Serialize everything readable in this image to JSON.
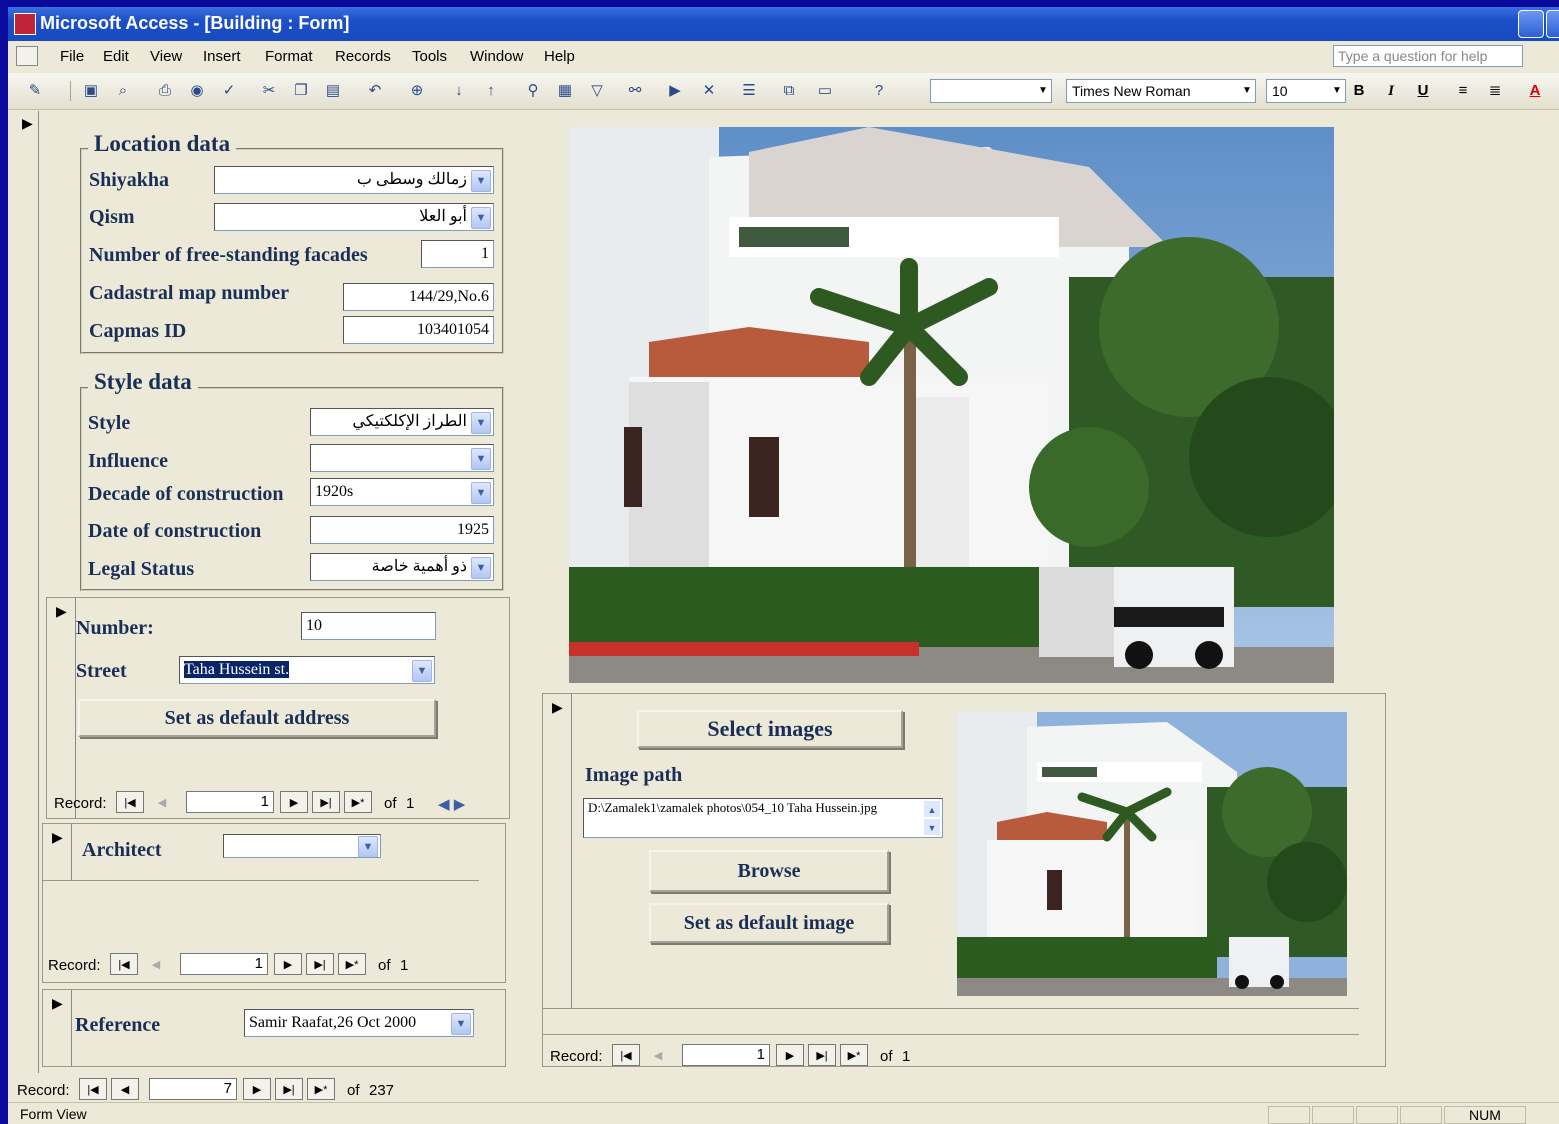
{
  "window": {
    "title": "Microsoft Access - [Building : Form]"
  },
  "menu": [
    "File",
    "Edit",
    "View",
    "Insert",
    "Format",
    "Records",
    "Tools",
    "Window",
    "Help"
  ],
  "help_placeholder": "Type a question for help",
  "toolbar": {
    "font": "Times New Roman",
    "size": "10",
    "bold": "B",
    "italic": "I",
    "underline": "U",
    "font_color": "A"
  },
  "location": {
    "title": "Location data",
    "shiyakha_label": "Shiyakha",
    "shiyakha_value": "زمالك وسطى ب",
    "qism_label": "Qism",
    "qism_value": "أبو العلا",
    "facades_label": "Number of free-standing facades",
    "facades_value": "1",
    "cadastral_label": "Cadastral map number",
    "cadastral_value": "144/29,No.6",
    "capmas_label": "Capmas ID",
    "capmas_value": "103401054"
  },
  "style": {
    "title": "Style data",
    "style_label": "Style",
    "style_value": "الطراز الإكلكتيكي",
    "influence_label": "Influence",
    "influence_value": "",
    "decade_label": "Decade of construction",
    "decade_value": "1920s",
    "date_label": "Date of construction",
    "date_value": "1925",
    "legal_label": "Legal Status",
    "legal_value": "ذو أهمية خاصة"
  },
  "address": {
    "number_label": "Number:",
    "number_value": "10",
    "street_label": "Street",
    "street_value": "Taha Hussein st.",
    "default_button": "Set as default address",
    "nav": {
      "label": "Record:",
      "current": "1",
      "of": "of",
      "total": "1"
    }
  },
  "architect": {
    "label": "Architect",
    "value": "",
    "nav": {
      "label": "Record:",
      "current": "1",
      "of": "of",
      "total": "1"
    }
  },
  "reference": {
    "label": "Reference",
    "value": "Samir Raafat,26 Oct 2000"
  },
  "main_nav": {
    "label": "Record:",
    "current": "7",
    "of": "of",
    "total": "237"
  },
  "images": {
    "select_button": "Select images",
    "path_label": "Image path",
    "path_value": "D:\\Zamalek1\\zamalek photos\\054_10 Taha Hussein.jpg",
    "browse_button": "Browse",
    "default_button": "Set as default image",
    "nav": {
      "label": "Record:",
      "current": "1",
      "of": "of",
      "total": "1"
    }
  },
  "status": {
    "view": "Form View",
    "num": "NUM"
  },
  "colors": {
    "label": "#1a2f57",
    "titlebar": "#1c4fc8",
    "form_bg": "#ece9d8"
  }
}
